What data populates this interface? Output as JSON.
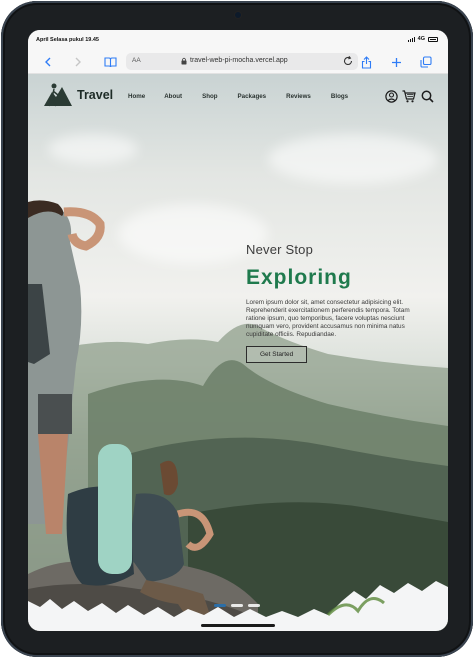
{
  "status_bar": {
    "time": "April Selasa pukul 19.45",
    "network": "4G"
  },
  "browser": {
    "reader_label": "AA",
    "url": "travel-web-pi-mocha.vercel.app",
    "accent_color": "#2f7cf6"
  },
  "site": {
    "brand": "Travel",
    "nav": [
      "Home",
      "About",
      "Shop",
      "Packages",
      "Reviews",
      "Blogs"
    ],
    "icons": [
      "user-icon",
      "cart-icon",
      "search-icon"
    ],
    "accent_color": "#1f7a4d"
  },
  "hero": {
    "kicker": "Never Stop",
    "title": "Exploring",
    "body": "Lorem ipsum dolor sit, amet consectetur adipisicing elit. Reprehenderit exercitationem perferendis tempora. Totam ratione ipsum, quo temporibus, facere voluptas nesciunt numquam vero, provident accusamus non minima natus cupiditate officiis. Repudiandae.",
    "button": "Get Started"
  },
  "carousel": {
    "slide_count": 3,
    "active_index": 0
  }
}
